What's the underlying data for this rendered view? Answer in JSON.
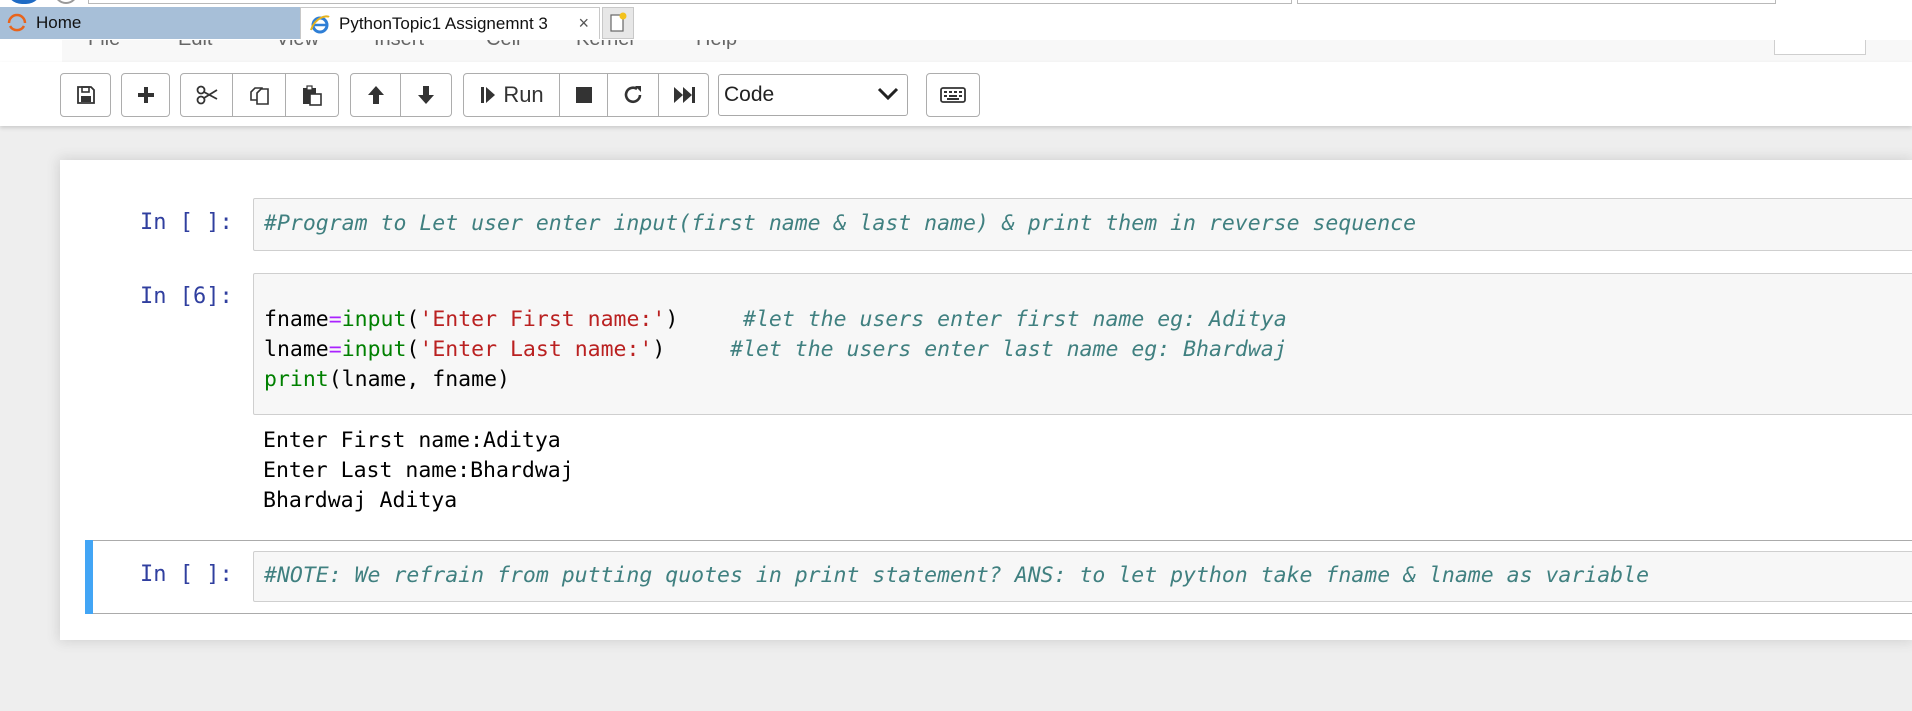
{
  "browser": {
    "tabs": [
      {
        "label": "Home",
        "active": false
      },
      {
        "label": "PythonTopic1 Assignemnt 3",
        "active": true
      }
    ],
    "close_glyph": "×"
  },
  "toolbar": {
    "run_label": "Run",
    "cell_type": "Code",
    "buttons": [
      "save-icon",
      "plus-icon",
      "cut-icon",
      "copy-icon",
      "paste-icon",
      "arrow-up-icon",
      "arrow-down-icon",
      "run-icon",
      "stop-icon",
      "restart-icon",
      "fast-forward-icon",
      "keyboard-icon"
    ]
  },
  "cells": [
    {
      "prompt": "In [ ]:",
      "source": "#Program to Let user enter input(first name & last name) & print them in reverse sequence"
    },
    {
      "prompt": "In [6]:",
      "lines": [
        {
          "var": "fname",
          "eq": "=",
          "fn": "input",
          "open": "(",
          "str": "'Enter First name:'",
          "close": ")",
          "pad": "     ",
          "comment": "#let the users enter first name eg: Aditya"
        },
        {
          "var": "lname",
          "eq": "=",
          "fn": "input",
          "open": "(",
          "str": "'Enter Last name:'",
          "close": ")",
          "pad": "     ",
          "comment": "#let the users enter last name eg: Bhardwaj"
        },
        {
          "fn": "print",
          "rest": "(lname, fname)"
        }
      ],
      "outputs": [
        "Enter First name:Aditya",
        "Enter Last name:Bhardwaj",
        "Bhardwaj Aditya"
      ]
    },
    {
      "prompt": "In [ ]:",
      "source": "#NOTE: We refrain from putting quotes in print statement? ANS: to let python take fname & lname as variable",
      "selected": true
    }
  ],
  "colors": {
    "prompt": "#303f9f",
    "comment": "#408080",
    "keyword": "#008000",
    "string": "#ba2121",
    "operator": "#aa22ff",
    "selection_bar": "#42a5f5"
  }
}
